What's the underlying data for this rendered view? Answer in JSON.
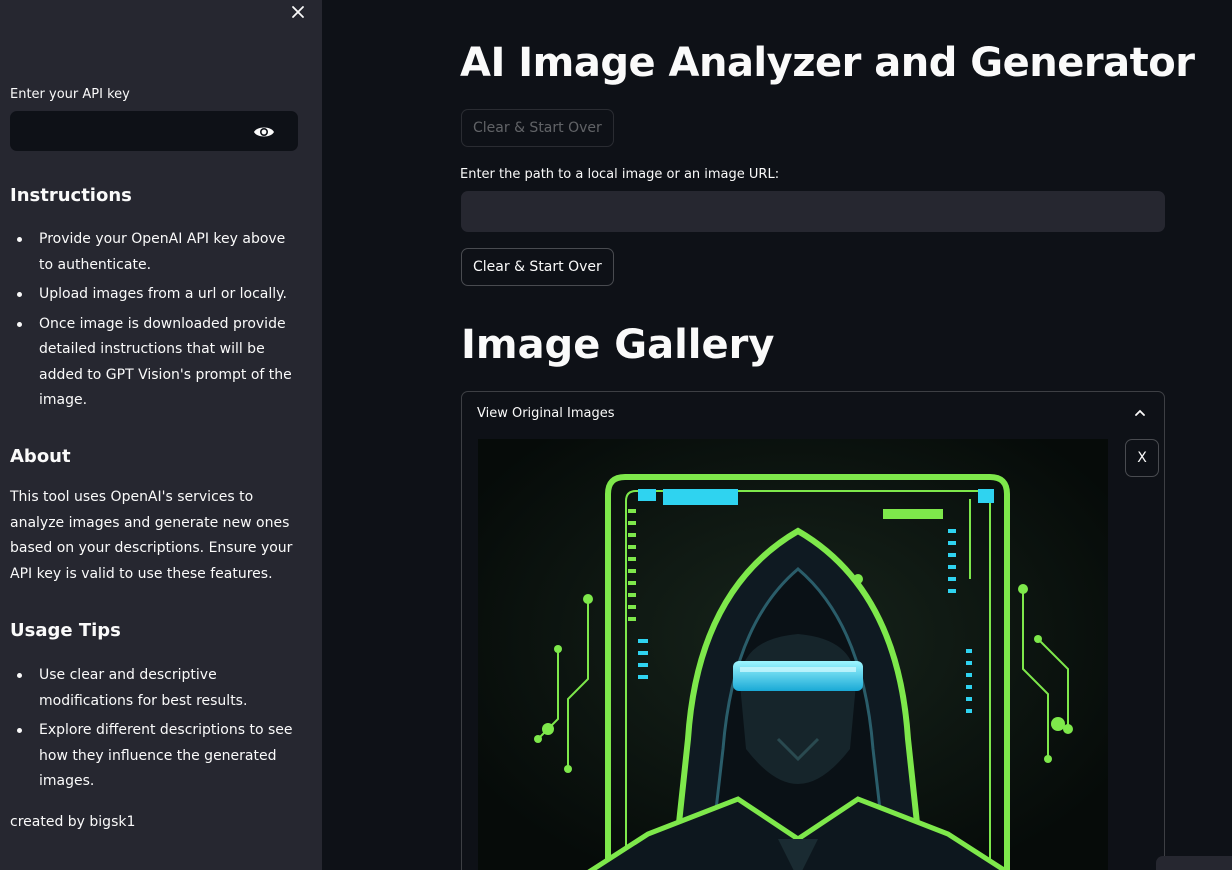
{
  "sidebar": {
    "api_key_label": "Enter your API key",
    "api_key_value": "",
    "instructions_heading": "Instructions",
    "instructions": [
      "Provide your OpenAI API key above to authenticate.",
      "Upload images from a url or locally.",
      "Once image is downloaded provide detailed instructions that will be added to GPT Vision's prompt of the image."
    ],
    "about_heading": "About",
    "about_text": "This tool uses OpenAI's services to analyze images and generate new ones based on your descriptions. Ensure your API key is valid to use these features.",
    "usage_heading": "Usage Tips",
    "usage_tips": [
      "Use clear and descriptive modifications for best results.",
      "Explore different descriptions to see how they influence the generated images."
    ],
    "footer": "created by bigsk1"
  },
  "main": {
    "title": "AI Image Analyzer and Generator",
    "clear_top_label": "Clear & Start Over",
    "path_label": "Enter the path to a local image or an image URL:",
    "path_value": "",
    "clear_bottom_label": "Clear & Start Over",
    "gallery_title": "Image Gallery",
    "expander_label": "View Original Images",
    "remove_label": "X"
  },
  "colors": {
    "background": "#0e1117",
    "sidebar": "#262730",
    "accent_green": "#7ee84b",
    "accent_cyan": "#2fd3f0"
  },
  "icons": [
    "close-icon",
    "eye-icon",
    "chevron-up-icon"
  ]
}
